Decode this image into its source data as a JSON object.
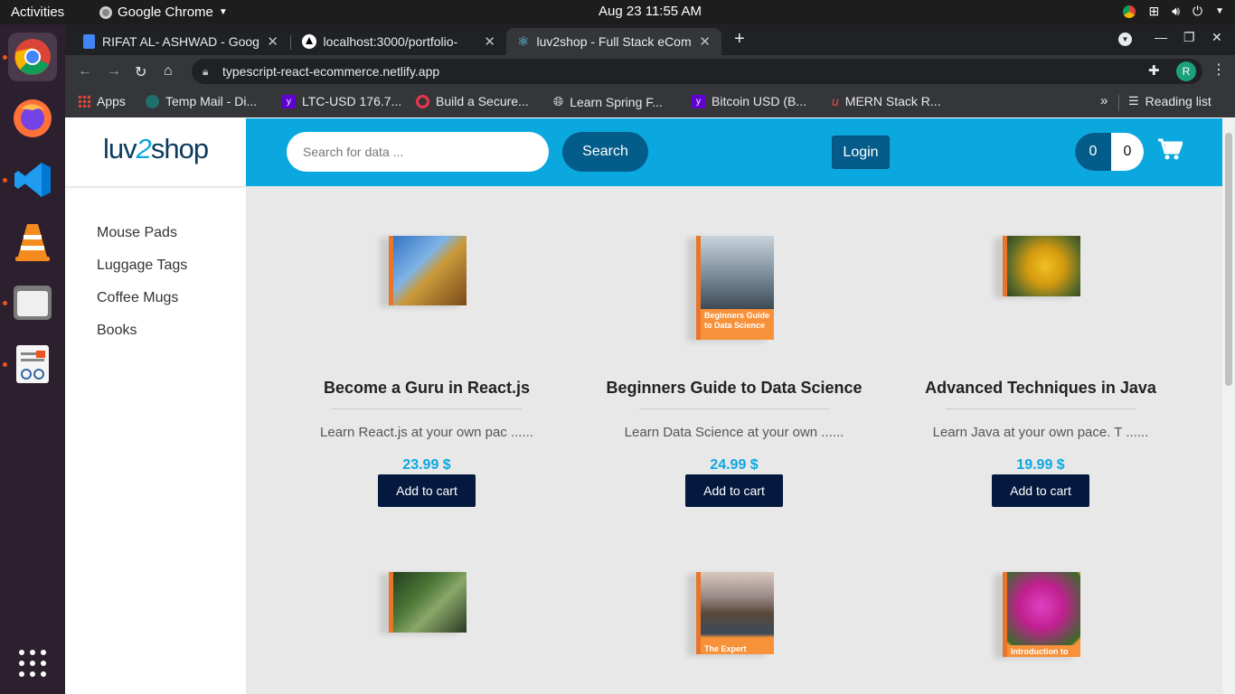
{
  "system": {
    "activities": "Activities",
    "app_menu": "Google Chrome",
    "clock": "Aug 23  11:55 AM"
  },
  "tabs": [
    {
      "title": "RIFAT AL- ASHWAD - Goog"
    },
    {
      "title": "localhost:3000/portfolio-"
    },
    {
      "title": "luv2shop - Full Stack eCom"
    }
  ],
  "address": {
    "url": "typescript-react-ecommerce.netlify.app",
    "profile_initial": "R"
  },
  "bookmarks": [
    {
      "label": "Apps"
    },
    {
      "label": "Temp Mail - Di..."
    },
    {
      "label": "LTC-USD 176.7..."
    },
    {
      "label": "Build a Secure..."
    },
    {
      "label": "Learn Spring F..."
    },
    {
      "label": "Bitcoin USD (B..."
    },
    {
      "label": "MERN Stack R..."
    }
  ],
  "reading_list": "Reading list",
  "shop": {
    "logo_text_a": "luv",
    "logo_text_b": "2",
    "logo_text_c": "shop",
    "categories": [
      "Mouse Pads",
      "Luggage Tags",
      "Coffee Mugs",
      "Books"
    ],
    "search_placeholder": "Search for data ...",
    "search_button": "Search",
    "login": "Login",
    "cart_total": "0",
    "cart_qty": "0",
    "products": [
      {
        "name": "Become a Guru in React.js",
        "desc": "Learn React.js at your own pac ......",
        "price": "23.99 $",
        "button": "Add to cart"
      },
      {
        "name": "Beginners Guide to Data Science",
        "desc": "Learn Data Science at your own ......",
        "price": "24.99 $",
        "button": "Add to cart",
        "cover_text": "Beginners Guide to Data Science"
      },
      {
        "name": "Advanced Techniques in Java",
        "desc": "Learn Java at your own pace. T ......",
        "price": "19.99 $",
        "button": "Add to cart"
      }
    ],
    "row2_covers": [
      "",
      "The Expert",
      "Introduction to"
    ]
  },
  "colors": {
    "header": "#0ba8e0",
    "button_dark": "#05193f",
    "search_btn": "#035c8a",
    "price": "#0ba8e0"
  }
}
